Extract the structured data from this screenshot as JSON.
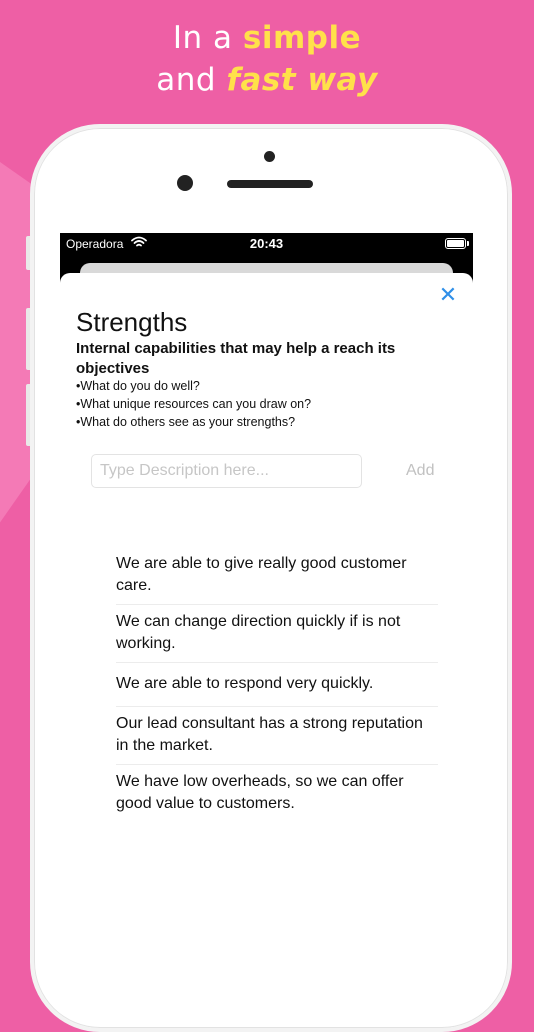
{
  "promo": {
    "line1_prefix": "In a ",
    "line1_highlight": "simple",
    "line2_prefix": "and ",
    "line2_highlight": "fast way"
  },
  "status_bar": {
    "carrier": "Operadora",
    "time": "20:43"
  },
  "sheet": {
    "title": "Strengths",
    "subtitle": "Internal capabilities that may help a reach its objectives",
    "bullets": [
      "•What do you do well?",
      "•What unique resources can you draw on?",
      "•What do others see as your strengths?"
    ],
    "input": {
      "placeholder": "Type Description here...",
      "value": ""
    },
    "add_label": "Add",
    "items": [
      "We are able to give really good customer care.",
      "We can change direction quickly if is not working.",
      "We are able to respond very quickly.",
      "Our lead consultant has a strong reputation in the market.",
      "We have low overheads, so we can offer good value to customers."
    ]
  },
  "colors": {
    "background": "#ee5fa5",
    "highlight": "#ffe14a",
    "accent": "#2f8fe8"
  },
  "icons": {
    "close": "close-icon",
    "wifi": "wifi-icon",
    "battery": "battery-icon"
  }
}
